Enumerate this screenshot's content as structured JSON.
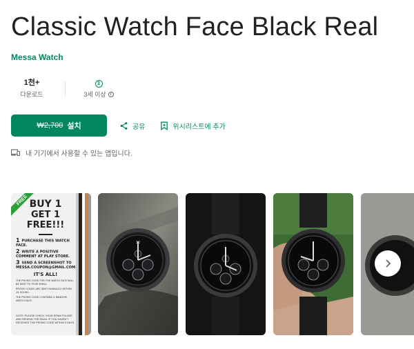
{
  "app": {
    "title": "Classic Watch Face Black Real",
    "developer": "Messa Watch"
  },
  "stats": {
    "downloads_value": "1천+",
    "downloads_label": "다운로드",
    "rating_badge": "3",
    "rating_label": "3세 이상"
  },
  "actions": {
    "price": "₩2,700",
    "install_label": "설치",
    "share_label": "공유",
    "wishlist_label": "위시리스트에 추가"
  },
  "device_note": "내 기기에서 사용할 수 있는 앱입니다.",
  "promo": {
    "ribbon": "FREE",
    "headline1": "BUY 1",
    "headline2": "GET 1 FREE!!!",
    "step1_num": "1",
    "step1_text": "PURCHASE THIS WATCH FACE.",
    "step2_num": "2",
    "step2_text": "WRITE A POSITIVE COMMENT AT PLAY STORE.",
    "step3_num": "3",
    "step3_text": "SEND A SCREENSHOT TO MESSA.COUPON@GMAIL.COM",
    "all_set": "IT'S ALL!",
    "fine_print1": "THE PROMO CODE FOR THE WATCH FACE WILL BE SENT TO YOUR EMAIL.",
    "fine_print2": "PROMO CODES ARE SENT MANUALLY WITHIN 24 HOURS.",
    "fine_print3": "THE PROMO CODE CONTAINS A RANDOM WATCH FACE.",
    "note": "NOTE: PLEASE CHECK YOUR SPAM FOLDER AND RESEND THE EMAIL IF YOU HAVEN'T RECEIVED THE PROMO CODE WITHIN 3 DAYS."
  },
  "colors": {
    "accent": "#01875f",
    "title": "#202124",
    "secondary": "#5f6368"
  },
  "icons": {
    "share": "share-icon",
    "wishlist": "bookmark-add-icon",
    "device": "devices-icon",
    "next": "chevron-right-icon",
    "info": "info-icon"
  }
}
